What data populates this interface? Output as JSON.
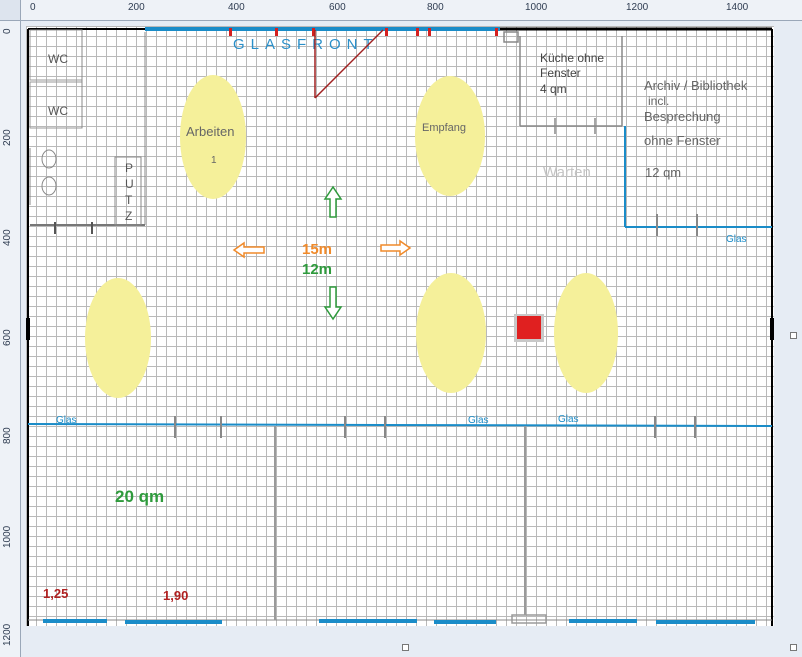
{
  "ruler": {
    "top_labels": [
      "0",
      "200",
      "400",
      "600",
      "800",
      "1000",
      "1200",
      "1400"
    ],
    "left_labels": [
      "0",
      "200",
      "400",
      "600",
      "800",
      "1000",
      "1200"
    ]
  },
  "plan": {
    "glasfront": "GLASFRONT",
    "wc1": "WC",
    "wc2": "WC",
    "putz_letters": [
      "P",
      "U",
      "T",
      "Z"
    ],
    "kueche": [
      "Küche ohne",
      "Fenster",
      "4 qm"
    ],
    "archiv": [
      "Archiv  / Bibliothek",
      "incl.",
      "Besprechung"
    ],
    "archiv_note": "ohne Fenster",
    "archiv_area": "12 qm",
    "arbeiten": "Arbeiten",
    "arbeiten_num": "1",
    "empfang": "Empfang",
    "warten": "Warten",
    "glas_labels": [
      "Glas",
      "Glas",
      "Glas",
      "Glas"
    ],
    "dim_width": "15m",
    "dim_depth": "12m",
    "room_area": "20 qm",
    "measure_1": "1,25",
    "measure_2": "1,90"
  },
  "colors": {
    "blue_line": "#1a8cc8",
    "glasfront_text": "#2a8fc9",
    "red": "#d42020",
    "yellow": "#f5f09a",
    "orange": "#f08a2a",
    "green": "#2e9a3c",
    "dark_red": "#b02020",
    "gray_text": "#707070",
    "wall": "#000000"
  }
}
